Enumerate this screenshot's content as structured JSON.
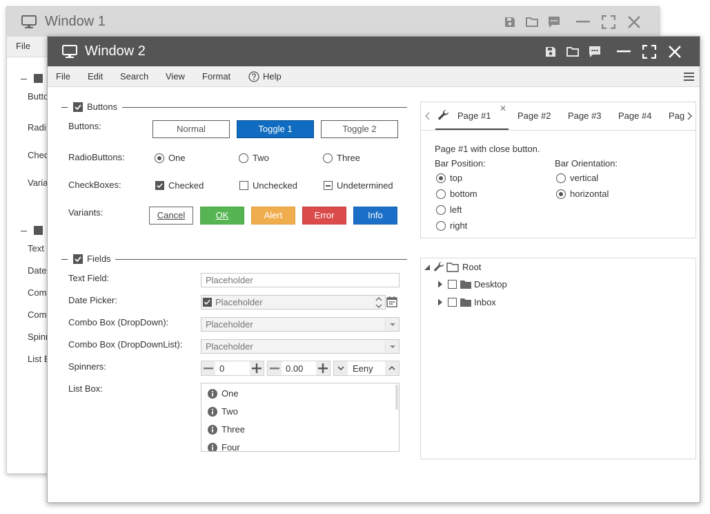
{
  "window1": {
    "title": "Window 1",
    "menu": {
      "file": "File"
    },
    "items": [
      "Butto",
      "Radi",
      "Chec",
      "Varia",
      "Text",
      "Date",
      "Comb",
      "Comb",
      "Spinn",
      "List B"
    ]
  },
  "window2": {
    "title": "Window 2",
    "menu": {
      "file": "File",
      "edit": "Edit",
      "search": "Search",
      "view": "View",
      "format": "Format",
      "help": "Help"
    },
    "buttons_section": {
      "title": "Buttons",
      "buttons_label": "Buttons:",
      "normal": "Normal",
      "toggle1": "Toggle 1",
      "toggle2": "Toggle 2",
      "radio_label": "RadioButtons:",
      "radios": [
        "One",
        "Two",
        "Three"
      ],
      "radio_selected": "One",
      "checkbox_label": "CheckBoxes:",
      "checkboxes": {
        "checked": "Checked",
        "unchecked": "Unchecked",
        "undetermined": "Undetermined"
      },
      "variants_label": "Variants:",
      "variants": {
        "cancel": "Cancel",
        "ok": "OK",
        "alert": "Alert",
        "error": "Error",
        "info": "Info"
      }
    },
    "fields_section": {
      "title": "Fields",
      "text_field_label": "Text Field:",
      "date_picker_label": "Date Picker:",
      "combo_dropdown_label": "Combo Box (DropDown):",
      "combo_dropdownlist_label": "Combo Box (DropDownList):",
      "spinners_label": "Spinners:",
      "listbox_label": "List Box:",
      "placeholder": "Placeholder",
      "spinner_int": "0",
      "spinner_dec": "0.00",
      "spinner_text": "Eeny",
      "listbox_items": [
        "One",
        "Two",
        "Three",
        "Four"
      ]
    },
    "tabs": {
      "items": [
        "Page #1",
        "Page #2",
        "Page #3",
        "Page #4",
        "Pag"
      ],
      "active": "Page #1",
      "content_text": "Page #1 with close button.",
      "bar_position_label": "Bar Position:",
      "bar_positions": [
        "top",
        "bottom",
        "left",
        "right"
      ],
      "bar_position_selected": "top",
      "bar_orientation_label": "Bar Orientation:",
      "bar_orientations": [
        "vertical",
        "horizontal"
      ],
      "bar_orientation_selected": "horizontal"
    },
    "tree": {
      "root": "Root",
      "children": [
        "Desktop",
        "Inbox"
      ]
    }
  },
  "colors": {
    "titlebar_active": "#555555",
    "titlebar_inactive": "#d9d9d9",
    "primary": "#0f6cc0",
    "ok": "#56b552",
    "alert": "#f0ad4e",
    "error": "#db4b4b",
    "info": "#1b6fc7"
  }
}
